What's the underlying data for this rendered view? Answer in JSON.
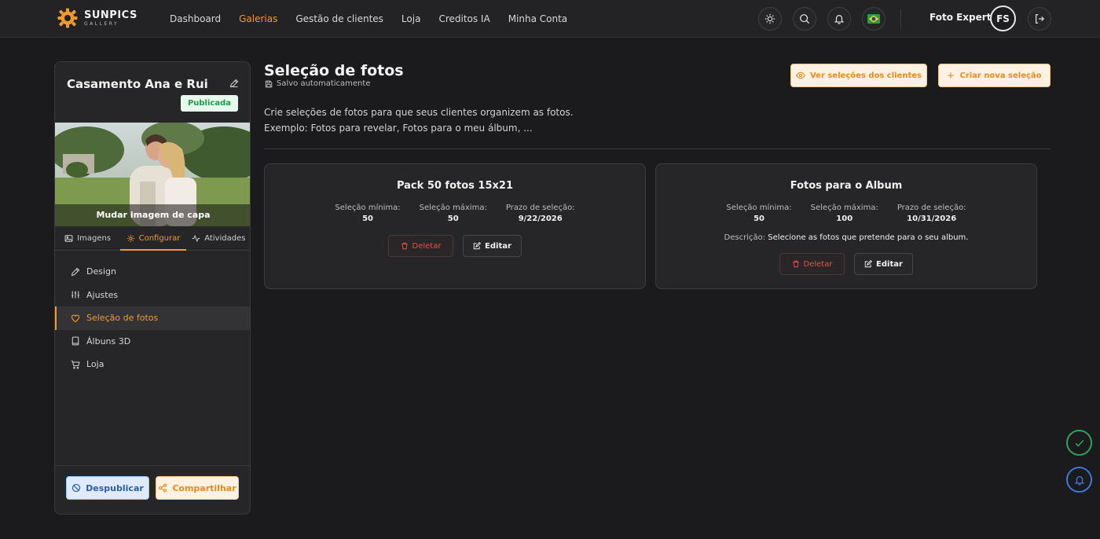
{
  "brand": {
    "name": "SUNPICS",
    "sub": "GALLERY",
    "accent": "#f29a2e"
  },
  "nav": [
    {
      "label": "Dashboard",
      "active": false
    },
    {
      "label": "Galerias",
      "active": true
    },
    {
      "label": "Gestão de clientes",
      "active": false
    },
    {
      "label": "Loja",
      "active": false
    },
    {
      "label": "Creditos IA",
      "active": false
    },
    {
      "label": "Minha Conta",
      "active": false
    }
  ],
  "topbar_icons": [
    "sun-icon",
    "search-icon",
    "bell-icon",
    "brazil-flag-icon",
    "logout-icon"
  ],
  "user": {
    "name": "Foto Expert",
    "initials": "FS"
  },
  "gallery": {
    "title": "Casamento Ana e Rui",
    "status": "Publicada",
    "cover_label": "Mudar imagem de capa"
  },
  "panel_tabs": [
    {
      "label": "Imagens",
      "icon": "image-icon",
      "active": false
    },
    {
      "label": "Configurar",
      "icon": "gear-icon",
      "active": true
    },
    {
      "label": "Atividades",
      "icon": "activity-icon",
      "active": false
    }
  ],
  "menu": [
    {
      "label": "Design",
      "icon": "pencil-icon",
      "active": false
    },
    {
      "label": "Ajustes",
      "icon": "sliders-icon",
      "active": false
    },
    {
      "label": "Seleção de fotos",
      "icon": "heart-icon",
      "active": true
    },
    {
      "label": "Álbuns 3D",
      "icon": "book-icon",
      "active": false
    },
    {
      "label": "Loja",
      "icon": "cart-icon",
      "active": false
    }
  ],
  "footer": {
    "unpublish": "Despublicar",
    "share": "Compartilhar"
  },
  "main": {
    "title": "Seleção de fotos",
    "autosave": "Salvo automaticamente",
    "view_btn": "Ver seleções dos clientes",
    "create_btn": "Criar nova seleção",
    "desc_line1": "Crie seleções de fotos para que seus clientes organizem as fotos.",
    "desc_line2": "Exemplo: Fotos para revelar, Fotos para o meu álbum, ..."
  },
  "labels": {
    "min": "Seleção mínima:",
    "max": "Seleção máxima:",
    "deadline": "Prazo de seleção:",
    "description": "Descrição:",
    "delete": "Deletar",
    "edit": "Editar"
  },
  "cards": [
    {
      "title": "Pack 50 fotos 15x21",
      "min": "50",
      "max": "50",
      "deadline": "9/22/2026",
      "description": ""
    },
    {
      "title": "Fotos para o Album",
      "min": "50",
      "max": "100",
      "deadline": "10/31/2026",
      "description": "Selecione as fotos que pretende para o seu album."
    }
  ]
}
